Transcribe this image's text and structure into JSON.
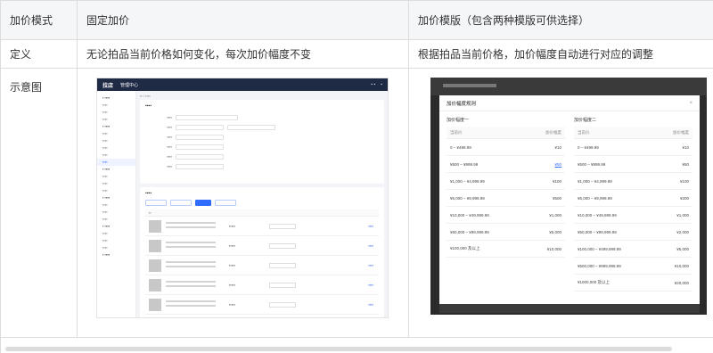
{
  "table": {
    "header": {
      "col1": "加价模式",
      "col2": "固定加价",
      "col3": "加价模版（包含两种模版可供选择）"
    },
    "definition": {
      "label": "定义",
      "fixed": "无论拍品当前价格如何变化，每次加价幅度不变",
      "template": "根据拍品当前价格，加价幅度自动进行对应的调整"
    },
    "diagram": {
      "label": "示意图"
    }
  },
  "admin_screenshot": {
    "logo": "拉店",
    "nav_title": "管理中心"
  },
  "price_modal": {
    "title": "加价幅度规则",
    "close": "×",
    "columns_header_left": "当前价",
    "columns_header_right": "加价幅度",
    "template1": {
      "name": "加价幅度一",
      "rows": [
        {
          "range": "0 – ¥499.99",
          "step": "¥10"
        },
        {
          "range": "¥500 – ¥999.99",
          "step": "¥50"
        },
        {
          "range": "¥1,000 – ¥4,999.99",
          "step": "¥100"
        },
        {
          "range": "¥5,000 – ¥9,999.99",
          "step": "¥500"
        },
        {
          "range": "¥10,000 – ¥49,999.99",
          "step": "¥1,000"
        },
        {
          "range": "¥50,000 – ¥99,999.99",
          "step": "¥5,000"
        },
        {
          "range": "¥100,000 及以上",
          "step": "¥10,000"
        }
      ]
    },
    "template2": {
      "name": "加价幅度二",
      "rows": [
        {
          "range": "0 – ¥499.99",
          "step": "¥10"
        },
        {
          "range": "¥500 – ¥999.99",
          "step": "¥50"
        },
        {
          "range": "¥1,000 – ¥4,999.99",
          "step": "¥100"
        },
        {
          "range": "¥5,000 – ¥9,999.99",
          "step": "¥200"
        },
        {
          "range": "¥10,000 – ¥49,999.99",
          "step": "¥1,000"
        },
        {
          "range": "¥50,000 – ¥99,999.99",
          "step": "¥2,000"
        },
        {
          "range": "¥100,000 – ¥499,999.99",
          "step": "¥5,000"
        },
        {
          "range": "¥500,000 – ¥999,999.99",
          "step": "¥10,000"
        },
        {
          "range": "¥1000,000 及以上",
          "step": "¥20,000"
        }
      ]
    }
  }
}
